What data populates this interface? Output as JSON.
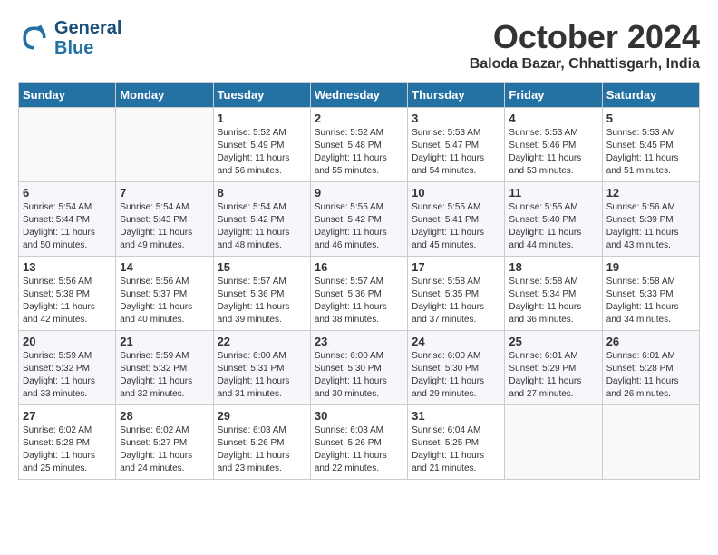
{
  "header": {
    "logo_line1": "General",
    "logo_line2": "Blue",
    "month": "October 2024",
    "location": "Baloda Bazar, Chhattisgarh, India"
  },
  "days_of_week": [
    "Sunday",
    "Monday",
    "Tuesday",
    "Wednesday",
    "Thursday",
    "Friday",
    "Saturday"
  ],
  "weeks": [
    [
      {
        "day": "",
        "sunrise": "",
        "sunset": "",
        "daylight": ""
      },
      {
        "day": "",
        "sunrise": "",
        "sunset": "",
        "daylight": ""
      },
      {
        "day": "1",
        "sunrise": "Sunrise: 5:52 AM",
        "sunset": "Sunset: 5:49 PM",
        "daylight": "Daylight: 11 hours and 56 minutes."
      },
      {
        "day": "2",
        "sunrise": "Sunrise: 5:52 AM",
        "sunset": "Sunset: 5:48 PM",
        "daylight": "Daylight: 11 hours and 55 minutes."
      },
      {
        "day": "3",
        "sunrise": "Sunrise: 5:53 AM",
        "sunset": "Sunset: 5:47 PM",
        "daylight": "Daylight: 11 hours and 54 minutes."
      },
      {
        "day": "4",
        "sunrise": "Sunrise: 5:53 AM",
        "sunset": "Sunset: 5:46 PM",
        "daylight": "Daylight: 11 hours and 53 minutes."
      },
      {
        "day": "5",
        "sunrise": "Sunrise: 5:53 AM",
        "sunset": "Sunset: 5:45 PM",
        "daylight": "Daylight: 11 hours and 51 minutes."
      }
    ],
    [
      {
        "day": "6",
        "sunrise": "Sunrise: 5:54 AM",
        "sunset": "Sunset: 5:44 PM",
        "daylight": "Daylight: 11 hours and 50 minutes."
      },
      {
        "day": "7",
        "sunrise": "Sunrise: 5:54 AM",
        "sunset": "Sunset: 5:43 PM",
        "daylight": "Daylight: 11 hours and 49 minutes."
      },
      {
        "day": "8",
        "sunrise": "Sunrise: 5:54 AM",
        "sunset": "Sunset: 5:42 PM",
        "daylight": "Daylight: 11 hours and 48 minutes."
      },
      {
        "day": "9",
        "sunrise": "Sunrise: 5:55 AM",
        "sunset": "Sunset: 5:42 PM",
        "daylight": "Daylight: 11 hours and 46 minutes."
      },
      {
        "day": "10",
        "sunrise": "Sunrise: 5:55 AM",
        "sunset": "Sunset: 5:41 PM",
        "daylight": "Daylight: 11 hours and 45 minutes."
      },
      {
        "day": "11",
        "sunrise": "Sunrise: 5:55 AM",
        "sunset": "Sunset: 5:40 PM",
        "daylight": "Daylight: 11 hours and 44 minutes."
      },
      {
        "day": "12",
        "sunrise": "Sunrise: 5:56 AM",
        "sunset": "Sunset: 5:39 PM",
        "daylight": "Daylight: 11 hours and 43 minutes."
      }
    ],
    [
      {
        "day": "13",
        "sunrise": "Sunrise: 5:56 AM",
        "sunset": "Sunset: 5:38 PM",
        "daylight": "Daylight: 11 hours and 42 minutes."
      },
      {
        "day": "14",
        "sunrise": "Sunrise: 5:56 AM",
        "sunset": "Sunset: 5:37 PM",
        "daylight": "Daylight: 11 hours and 40 minutes."
      },
      {
        "day": "15",
        "sunrise": "Sunrise: 5:57 AM",
        "sunset": "Sunset: 5:36 PM",
        "daylight": "Daylight: 11 hours and 39 minutes."
      },
      {
        "day": "16",
        "sunrise": "Sunrise: 5:57 AM",
        "sunset": "Sunset: 5:36 PM",
        "daylight": "Daylight: 11 hours and 38 minutes."
      },
      {
        "day": "17",
        "sunrise": "Sunrise: 5:58 AM",
        "sunset": "Sunset: 5:35 PM",
        "daylight": "Daylight: 11 hours and 37 minutes."
      },
      {
        "day": "18",
        "sunrise": "Sunrise: 5:58 AM",
        "sunset": "Sunset: 5:34 PM",
        "daylight": "Daylight: 11 hours and 36 minutes."
      },
      {
        "day": "19",
        "sunrise": "Sunrise: 5:58 AM",
        "sunset": "Sunset: 5:33 PM",
        "daylight": "Daylight: 11 hours and 34 minutes."
      }
    ],
    [
      {
        "day": "20",
        "sunrise": "Sunrise: 5:59 AM",
        "sunset": "Sunset: 5:32 PM",
        "daylight": "Daylight: 11 hours and 33 minutes."
      },
      {
        "day": "21",
        "sunrise": "Sunrise: 5:59 AM",
        "sunset": "Sunset: 5:32 PM",
        "daylight": "Daylight: 11 hours and 32 minutes."
      },
      {
        "day": "22",
        "sunrise": "Sunrise: 6:00 AM",
        "sunset": "Sunset: 5:31 PM",
        "daylight": "Daylight: 11 hours and 31 minutes."
      },
      {
        "day": "23",
        "sunrise": "Sunrise: 6:00 AM",
        "sunset": "Sunset: 5:30 PM",
        "daylight": "Daylight: 11 hours and 30 minutes."
      },
      {
        "day": "24",
        "sunrise": "Sunrise: 6:00 AM",
        "sunset": "Sunset: 5:30 PM",
        "daylight": "Daylight: 11 hours and 29 minutes."
      },
      {
        "day": "25",
        "sunrise": "Sunrise: 6:01 AM",
        "sunset": "Sunset: 5:29 PM",
        "daylight": "Daylight: 11 hours and 27 minutes."
      },
      {
        "day": "26",
        "sunrise": "Sunrise: 6:01 AM",
        "sunset": "Sunset: 5:28 PM",
        "daylight": "Daylight: 11 hours and 26 minutes."
      }
    ],
    [
      {
        "day": "27",
        "sunrise": "Sunrise: 6:02 AM",
        "sunset": "Sunset: 5:28 PM",
        "daylight": "Daylight: 11 hours and 25 minutes."
      },
      {
        "day": "28",
        "sunrise": "Sunrise: 6:02 AM",
        "sunset": "Sunset: 5:27 PM",
        "daylight": "Daylight: 11 hours and 24 minutes."
      },
      {
        "day": "29",
        "sunrise": "Sunrise: 6:03 AM",
        "sunset": "Sunset: 5:26 PM",
        "daylight": "Daylight: 11 hours and 23 minutes."
      },
      {
        "day": "30",
        "sunrise": "Sunrise: 6:03 AM",
        "sunset": "Sunset: 5:26 PM",
        "daylight": "Daylight: 11 hours and 22 minutes."
      },
      {
        "day": "31",
        "sunrise": "Sunrise: 6:04 AM",
        "sunset": "Sunset: 5:25 PM",
        "daylight": "Daylight: 11 hours and 21 minutes."
      },
      {
        "day": "",
        "sunrise": "",
        "sunset": "",
        "daylight": ""
      },
      {
        "day": "",
        "sunrise": "",
        "sunset": "",
        "daylight": ""
      }
    ]
  ]
}
